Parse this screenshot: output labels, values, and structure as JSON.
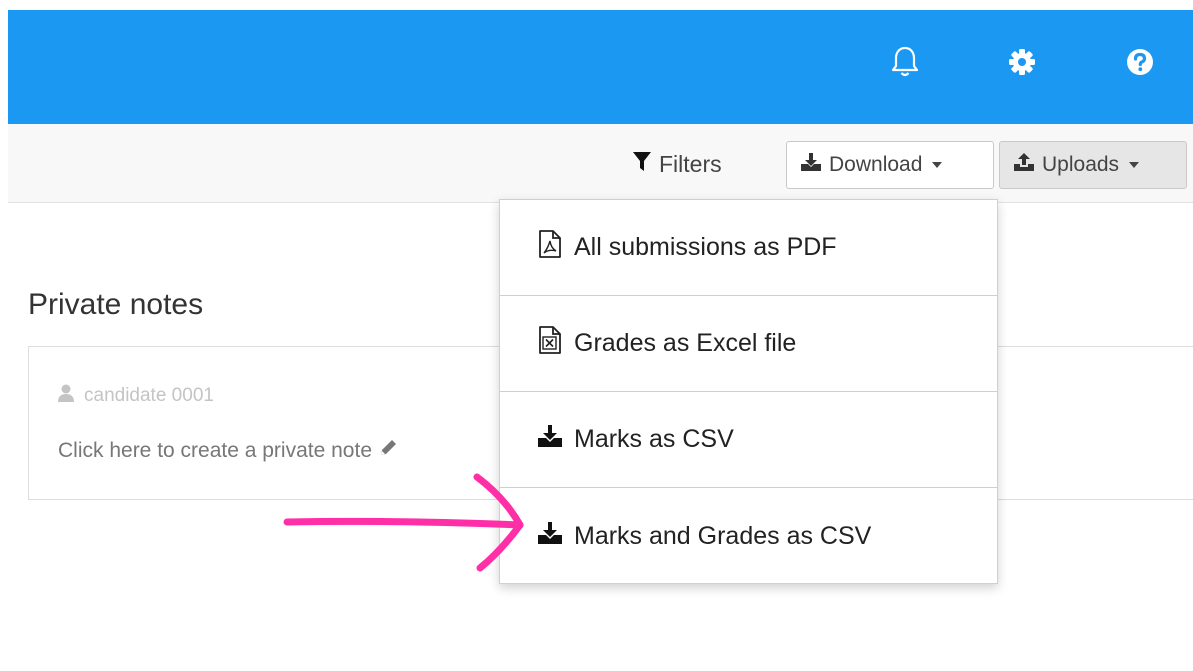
{
  "topbar": {
    "color": "#1a98f2",
    "icons": [
      "bell-icon",
      "gear-icon",
      "help-icon"
    ]
  },
  "toolbar": {
    "filters_label": "Filters",
    "download_label": "Download",
    "uploads_label": "Uploads"
  },
  "dropdown": {
    "items": [
      {
        "label": "All submissions as PDF",
        "icon": "pdf-file-icon"
      },
      {
        "label": "Grades as Excel file",
        "icon": "excel-file-icon"
      },
      {
        "label": "Marks as CSV",
        "icon": "download-icon"
      },
      {
        "label": "Marks and Grades as CSV",
        "icon": "download-icon"
      }
    ]
  },
  "notes": {
    "title": "Private notes",
    "candidate": "candidate 0001",
    "create_prompt": "Click here to create a private note"
  },
  "annotation": {
    "color": "#ff2fa8"
  }
}
